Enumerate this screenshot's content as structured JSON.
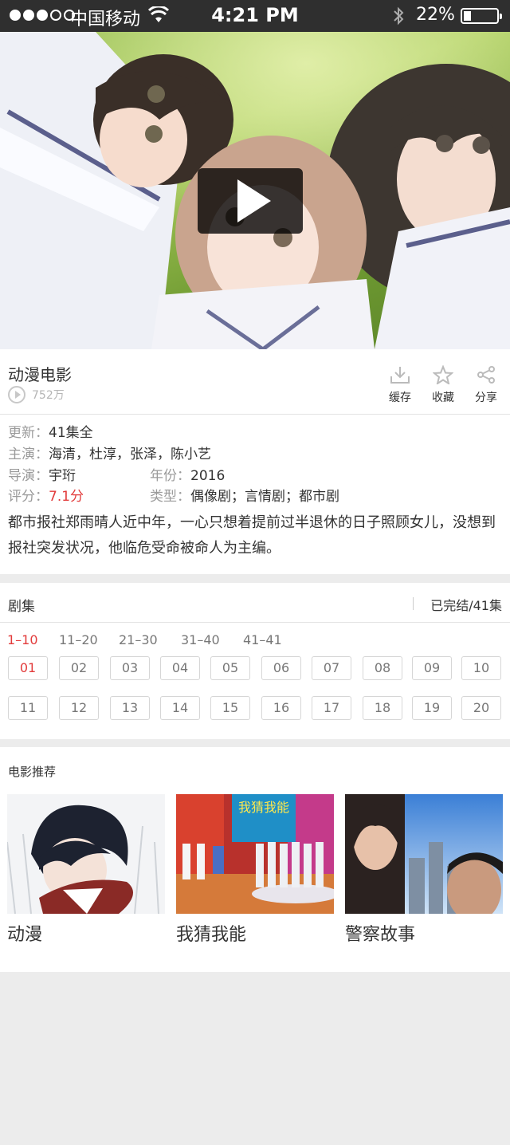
{
  "status_bar": {
    "carrier": "中国移动",
    "time": "4:21 PM",
    "battery": "22%",
    "battery_level": 0.22,
    "signal_bars_filled": 3,
    "signal_bars_total": 5
  },
  "video": {
    "title": "动漫电影",
    "views": "752万",
    "actions": [
      {
        "label": "缓存",
        "icon": "download-icon"
      },
      {
        "label": "收藏",
        "icon": "star-icon"
      },
      {
        "label": "分享",
        "icon": "share-icon"
      }
    ]
  },
  "details": {
    "update_label": "更新：",
    "update_value": "41集全",
    "cast_label": "主演：",
    "cast_value": "海清，杜淳，张泽，陈小艺",
    "director_label": "导演：",
    "director_value": "宇珩",
    "year_label": "年份：",
    "year_value": "2016",
    "rating_label": "评分：",
    "rating_value": "7.1分",
    "genre_label": "类型：",
    "genre_value": "偶像剧；言情剧；都市剧",
    "description": "都市报社郑雨晴人近中年，一心只想着提前过半退休的日子照顾女儿，没想到报社突发状况，他临危受命被命人为主编。"
  },
  "episodes": {
    "label": "剧集",
    "status": "已完结/41集",
    "ranges": [
      "1–10",
      "11–20",
      "21–30",
      "31–40",
      "41–41"
    ],
    "active_range": 0,
    "items": [
      "01",
      "02",
      "03",
      "04",
      "05",
      "06",
      "07",
      "08",
      "09",
      "10",
      "11",
      "12",
      "13",
      "14",
      "15",
      "16",
      "17",
      "18",
      "19",
      "20"
    ],
    "active_item": 0
  },
  "recommend": {
    "label": "电影推荐",
    "items": [
      {
        "title": "动漫"
      },
      {
        "title": "我猜我能"
      },
      {
        "title": "警察故事"
      }
    ]
  },
  "colors": {
    "accent": "#e23b3b",
    "status_bar": "#2f2f2f",
    "page_bg": "#ececec"
  }
}
